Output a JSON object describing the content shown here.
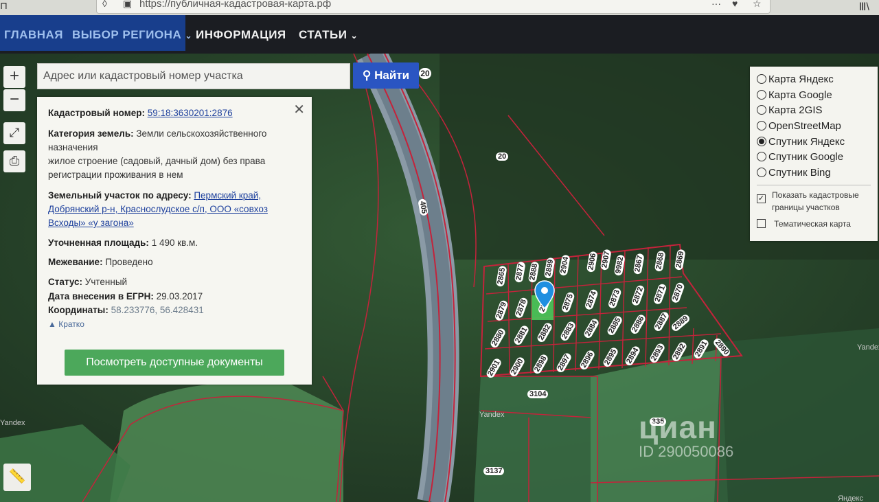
{
  "browser": {
    "url": "https://публичная-кадастровая-карта.рф"
  },
  "nav": {
    "items": [
      {
        "label": "ГЛАВНАЯ"
      },
      {
        "label": "ВЫБОР РЕГИОНА",
        "dropdown": true
      },
      {
        "label": "ИНФОРМАЦИЯ"
      },
      {
        "label": "СТАТЬИ",
        "dropdown": true
      }
    ]
  },
  "search": {
    "placeholder": "Адрес или кадастровый номер участка",
    "button_label": "Найти"
  },
  "map_controls": {
    "zoom_in": "+",
    "zoom_out": "−"
  },
  "info_panel": {
    "cadastral_label": "Кадастровый номер:",
    "cadastral_value": "59:18:3630201:2876",
    "category_label": "Категория земель:",
    "category_value_1": "Земли сельскохозяйственного назначения",
    "category_value_2": "жилое строение (садовый, дачный дом) без права регистрации проживания в нем",
    "address_label": "Земельный участок по адресу:",
    "address_value": "Пермский край, Добрянский р-н, Краснослудское с/п, ООО «совхоз Всходы» «у загона»",
    "area_label": "Уточненная площадь:",
    "area_value": "1 490 кв.м.",
    "survey_label": "Межевание:",
    "survey_value": "Проведено",
    "status_label": "Статус:",
    "status_value": "Учтенный",
    "egrn_label": "Дата внесения в ЕГРН:",
    "egrn_value": "29.03.2017",
    "coords_label": "Координаты:",
    "coords_value": "58.233776, 56.428431",
    "brief_link": "Кратко",
    "docs_button": "Посмотреть доступные документы"
  },
  "layers": {
    "options": [
      {
        "label": "Карта Яндекс",
        "selected": false
      },
      {
        "label": "Карта Google",
        "selected": false
      },
      {
        "label": "Карта 2GIS",
        "selected": false
      },
      {
        "label": "OpenStreetMap",
        "selected": false
      },
      {
        "label": "Спутник Яндекс",
        "selected": true
      },
      {
        "label": "Спутник Google",
        "selected": false
      },
      {
        "label": "Спутник Bing",
        "selected": false
      }
    ],
    "show_borders_label": "Показать кадастровые границы участков",
    "show_borders_checked": true,
    "thematic_label": "Тематическая карта",
    "thematic_checked": false
  },
  "map_labels": {
    "road": "405",
    "l20a": "20",
    "l20b": "20",
    "l3104": "3104",
    "l335": "335",
    "l3137": "3137",
    "yandex1": "Yandex",
    "yandex2": "Yandex",
    "yandex3": "Yandex",
    "yandex4": "Яндекс"
  },
  "parcels": {
    "row1": [
      "2865",
      "2877",
      "2888",
      "2899",
      "2904",
      "2906",
      "2907",
      "9982",
      "2867",
      "2868",
      "2869"
    ],
    "row2": [
      "2879",
      "2878",
      "2876",
      "2875",
      "2874",
      "2873",
      "2872",
      "2871",
      "2870"
    ],
    "row3": [
      "2880",
      "2881",
      "2882",
      "2883",
      "2884",
      "2885",
      "2886",
      "2887",
      "2889"
    ],
    "row4": [
      "2901",
      "2900",
      "2898",
      "2897",
      "2896",
      "2895",
      "2894",
      "2893",
      "2892",
      "2891",
      "2890"
    ]
  },
  "watermark": {
    "logo": "циан",
    "id": "ID 290050086"
  },
  "colors": {
    "nav_bg": "#1b1d22",
    "nav_active": "#183e8c",
    "search_button": "#2a55c2",
    "docs_button": "#4ca85b",
    "parcel_border": "#c4233b",
    "marker": "#1f8fe0"
  }
}
